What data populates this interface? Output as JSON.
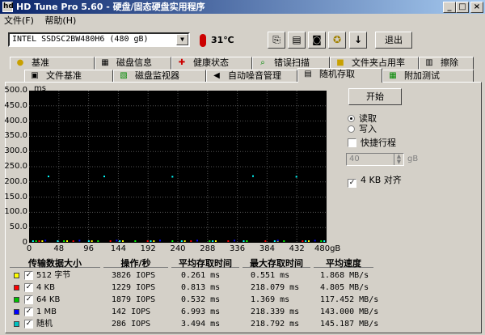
{
  "window": {
    "title": "HD Tune Pro 5.60 - 硬盘/固态硬盘实用程序",
    "app_icon": "hd",
    "min": "_",
    "max": "□",
    "close": "×"
  },
  "menu": [
    "文件(F)",
    "帮助(H)"
  ],
  "toolbar": {
    "drive": "INTEL SSDSC2BW480H6 (480 gB)",
    "temperature": "31℃",
    "exit_label": "退出"
  },
  "tabs_top": [
    "基准",
    "磁盘信息",
    "健康状态",
    "错误扫描",
    "文件夹占用率",
    "擦除"
  ],
  "tabs_bottom": [
    "文件基准",
    "磁盘监视器",
    "自动噪音管理",
    "随机存取",
    "附加测试"
  ],
  "chart": {
    "y_unit": "ms",
    "x_unit": "gB",
    "x_ticks": [
      "0",
      "48",
      "96",
      "144",
      "192",
      "240",
      "288",
      "336",
      "384",
      "432",
      "480gB"
    ],
    "y_ticks": [
      "500.0",
      "450.0",
      "400.0",
      "350.0",
      "300.0",
      "250.0",
      "200.0",
      "150.0",
      "100.0",
      "50.0",
      "0"
    ]
  },
  "chart_data": {
    "type": "scatter",
    "xlabel": "gB",
    "ylabel": "ms",
    "xlim": [
      0,
      480
    ],
    "ylim": [
      0,
      500
    ],
    "series": [
      {
        "name": "512 字节",
        "color": "#ffff00",
        "points": [
          [
            20,
            0.3
          ],
          [
            60,
            0.2
          ],
          [
            100,
            0.3
          ],
          [
            150,
            0.2
          ],
          [
            200,
            0.3
          ],
          [
            250,
            0.2
          ],
          [
            300,
            0.3
          ],
          [
            350,
            0.2
          ],
          [
            400,
            0.3
          ],
          [
            450,
            0.2
          ]
        ]
      },
      {
        "name": "4 KB",
        "color": "#ff0000",
        "points": [
          [
            15,
            0.8
          ],
          [
            70,
            0.7
          ],
          [
            130,
            0.9
          ],
          [
            190,
            0.8
          ],
          [
            260,
            0.8
          ],
          [
            320,
            0.9
          ],
          [
            380,
            0.8
          ],
          [
            440,
            0.7
          ]
        ]
      },
      {
        "name": "64 KB",
        "color": "#00ff00",
        "points": [
          [
            10,
            0.5
          ],
          [
            55,
            0.6
          ],
          [
            110,
            0.5
          ],
          [
            170,
            0.5
          ],
          [
            230,
            0.6
          ],
          [
            290,
            0.5
          ],
          [
            350,
            0.5
          ],
          [
            410,
            0.6
          ],
          [
            470,
            0.5
          ]
        ]
      },
      {
        "name": "1 MB",
        "color": "#0000ff",
        "points": [
          [
            25,
            7.0
          ],
          [
            80,
            6.9
          ],
          [
            140,
            7.0
          ],
          [
            210,
            7.1
          ],
          [
            270,
            6.9
          ],
          [
            330,
            7.0
          ],
          [
            400,
            7.0
          ],
          [
            460,
            6.9
          ]
        ]
      },
      {
        "name": "随机",
        "color": "#00ffff",
        "points": [
          [
            5,
            3.5
          ],
          [
            45,
            3.4
          ],
          [
            95,
            3.5
          ],
          [
            145,
            3.6
          ],
          [
            195,
            3.5
          ],
          [
            245,
            3.4
          ],
          [
            295,
            3.5
          ],
          [
            345,
            3.5
          ],
          [
            395,
            3.4
          ],
          [
            445,
            3.5
          ],
          [
            475,
            3.5
          ],
          [
            120,
            218
          ],
          [
            230,
            217
          ],
          [
            360,
            219
          ],
          [
            30,
            218
          ],
          [
            430,
            217
          ]
        ]
      }
    ]
  },
  "controls": {
    "start": "开始",
    "read": "读取",
    "write": "写入",
    "short_stroke": "快捷行程",
    "stroke_value": "40",
    "stroke_unit": "gB",
    "align": "4 KB 对齐",
    "read_selected": true,
    "short_checked": false,
    "align_checked": true
  },
  "table": {
    "headers": [
      "传输数据大小",
      "操作/秒",
      "平均存取时间",
      "最大存取时间",
      "平均速度"
    ],
    "rows": [
      {
        "color": "#ffff00",
        "checked": true,
        "label": "512 字节",
        "ops": "3826 IOPS",
        "avg": "0.261 ms",
        "max": "0.551 ms",
        "speed": "1.868 MB/s"
      },
      {
        "color": "#ff0000",
        "checked": true,
        "label": "4 KB",
        "ops": "1229 IOPS",
        "avg": "0.813 ms",
        "max": "218.079 ms",
        "speed": "4.805 MB/s"
      },
      {
        "color": "#00c000",
        "checked": true,
        "label": "64 KB",
        "ops": "1879 IOPS",
        "avg": "0.532 ms",
        "max": "1.369 ms",
        "speed": "117.452 MB/s"
      },
      {
        "color": "#0000ff",
        "checked": true,
        "label": "1 MB",
        "ops": "142 IOPS",
        "avg": "6.993 ms",
        "max": "218.339 ms",
        "speed": "143.000 MB/s"
      },
      {
        "color": "#00c0c0",
        "checked": true,
        "label": "随机",
        "ops": "286 IOPS",
        "avg": "3.494 ms",
        "max": "218.792 ms",
        "speed": "145.187 MB/s"
      }
    ]
  }
}
